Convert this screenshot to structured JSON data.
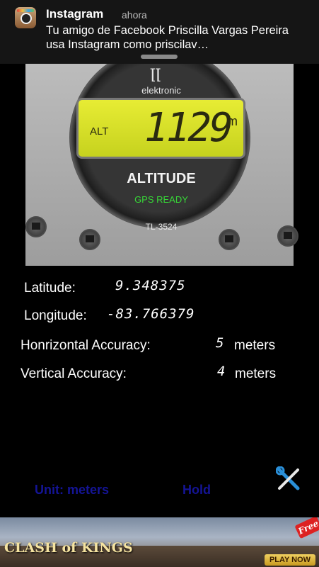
{
  "notification": {
    "app": "Instagram",
    "time": "ahora",
    "message": "Tu amigo de Facebook Priscilla Vargas Pereira usa Instagram como priscilav…"
  },
  "gauge": {
    "brand": "elektronic",
    "lcd_label": "ALT",
    "altitude_value": "1129",
    "altitude_unit": "m",
    "title": "ALTITUDE",
    "status": "GPS READY",
    "model": "TL-3524"
  },
  "readouts": {
    "latitude_label": "Latitude:",
    "latitude_value": "9.348375",
    "longitude_label": "Longitude:",
    "longitude_value": "-83.766379",
    "h_accuracy_label": "Honrizontal Accuracy:",
    "h_accuracy_value": "5",
    "h_accuracy_unit": "meters",
    "v_accuracy_label": "Vertical Accuracy:",
    "v_accuracy_value": "4",
    "v_accuracy_unit": "meters"
  },
  "controls": {
    "unit_button": "Unit: meters",
    "hold_button": "Hold",
    "settings_icon": "wrench-screwdriver-icon"
  },
  "ad": {
    "logo": "CLASH of KINGS",
    "badge": "Free",
    "cta": "PLAY NOW"
  },
  "colors": {
    "lcd": "#d6df28",
    "gps_ready": "#37d837",
    "button_text": "#141496"
  }
}
